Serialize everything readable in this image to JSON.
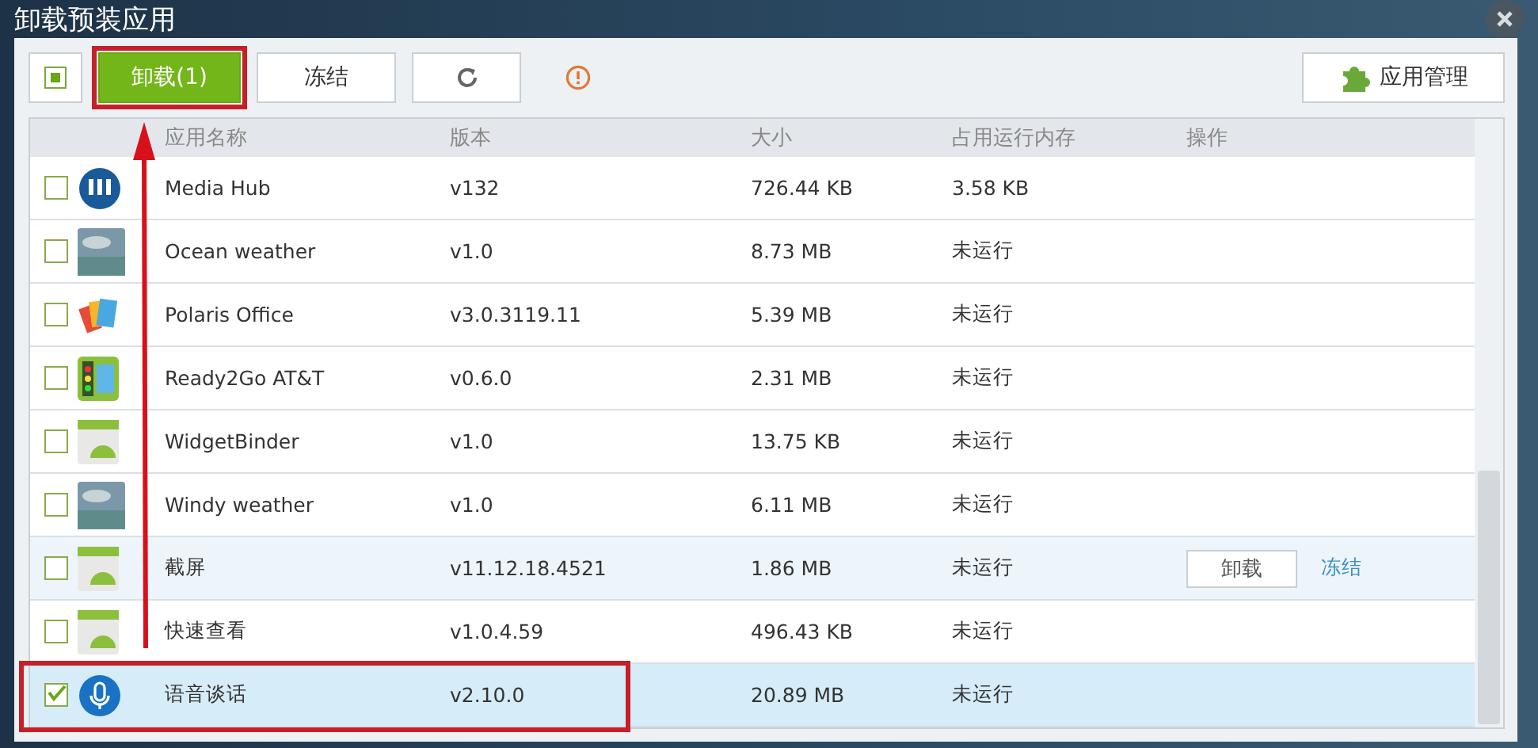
{
  "window": {
    "title": "卸载预装应用"
  },
  "toolbar": {
    "select_all": {
      "indeterminate": true
    },
    "buttons": [
      {
        "kind": "primary",
        "label": "卸载(1)",
        "highlighted": true
      },
      {
        "kind": "plain",
        "label": "冻结",
        "highlighted": false
      },
      {
        "kind": "refresh",
        "highlighted": false
      }
    ],
    "manage_button": {
      "label": "应用管理"
    }
  },
  "table": {
    "columns": [
      "应用名称",
      "版本",
      "大小",
      "占用运行内存",
      "操作"
    ],
    "rows": [
      {
        "kind": "hub",
        "name": "Media Hub",
        "version": "v132",
        "size": "726.44 KB",
        "memory": "3.58 KB",
        "checked": false,
        "selected": false,
        "hovered": false
      },
      {
        "kind": "weather",
        "name": "Ocean weather",
        "version": "v1.0",
        "size": "8.73 MB",
        "memory": "未运行",
        "checked": false,
        "selected": false,
        "hovered": false
      },
      {
        "kind": "office",
        "name": "Polaris Office",
        "version": "v3.0.3119.11",
        "size": "5.39 MB",
        "memory": "未运行",
        "checked": false,
        "selected": false,
        "hovered": false
      },
      {
        "kind": "ready",
        "name": "Ready2Go AT&T",
        "version": "v0.6.0",
        "size": "2.31 MB",
        "memory": "未运行",
        "checked": false,
        "selected": false,
        "hovered": false
      },
      {
        "kind": "android",
        "name": "WidgetBinder",
        "version": "v1.0",
        "size": "13.75 KB",
        "memory": "未运行",
        "checked": false,
        "selected": false,
        "hovered": false
      },
      {
        "kind": "weather",
        "name": "Windy weather",
        "version": "v1.0",
        "size": "6.11 MB",
        "memory": "未运行",
        "checked": false,
        "selected": false,
        "hovered": false
      },
      {
        "kind": "android",
        "name": "截屏",
        "version": "v11.12.18.4521",
        "size": "1.86 MB",
        "memory": "未运行",
        "checked": false,
        "selected": false,
        "hovered": true,
        "actions": {
          "uninstall": "卸载",
          "freeze": "冻结"
        }
      },
      {
        "kind": "android",
        "name": "快速查看",
        "version": "v1.0.4.59",
        "size": "496.43 KB",
        "memory": "未运行",
        "checked": false,
        "selected": false,
        "hovered": false
      },
      {
        "kind": "mic",
        "name": "语音谈话",
        "version": "v2.10.0",
        "size": "20.89 MB",
        "memory": "未运行",
        "checked": true,
        "selected": true,
        "hovered": false,
        "highlighted": true
      }
    ]
  }
}
